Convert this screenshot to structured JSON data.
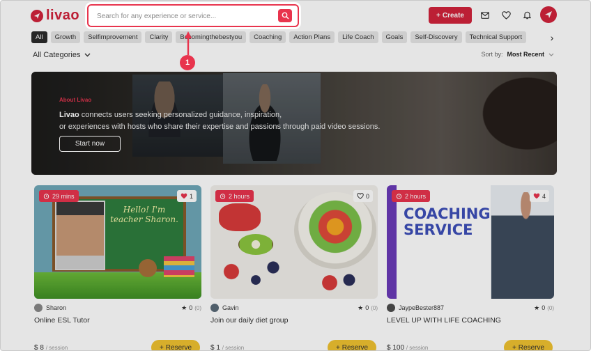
{
  "brand": {
    "name": "livao"
  },
  "search": {
    "placeholder": "Search for any experience or service..."
  },
  "header": {
    "create_label": "Create"
  },
  "categories": [
    "All",
    "Growth",
    "Selfimprovement",
    "Clarity",
    "Becomingthebestyou",
    "Coaching",
    "Action Plans",
    "Life Coach",
    "Goals",
    "Self-Discovery",
    "Technical Support"
  ],
  "filters": {
    "all_categories": "All Categories",
    "sort_label": "Sort by:",
    "sort_value": "Most Recent"
  },
  "hero": {
    "tag": "About Livao",
    "brand": "Livao",
    "text_line1": " connects users seeking personalized guidance, inspiration,",
    "text_line2": "or experiences with hosts who share their expertise and passions through paid video sessions.",
    "button": "Start now"
  },
  "cards": [
    {
      "duration": "29 mins",
      "likes": "1",
      "liked": true,
      "host": "Sharon",
      "rating": "0",
      "rating_count": "(0)",
      "title": "Online ESL Tutor",
      "price": "$ 8",
      "price_unit": "/ session",
      "reserve": "Reserve",
      "image_text": "Hello! I'm teacher Sharon."
    },
    {
      "duration": "2 hours",
      "likes": "0",
      "liked": false,
      "host": "Gavin",
      "rating": "0",
      "rating_count": "(0)",
      "title": "Join our daily diet group",
      "price": "$ 1",
      "price_unit": "/ session",
      "reserve": "Reserve"
    },
    {
      "duration": "2 hours",
      "likes": "4",
      "liked": true,
      "host": "JaypeBester887",
      "rating": "0",
      "rating_count": "(0)",
      "title": "LEVEL UP WITH LIFE COACHING",
      "price": "$ 100",
      "price_unit": "/ session",
      "reserve": "Reserve",
      "image_text": "COACHING SERVICE"
    }
  ],
  "annotation": {
    "step": "1"
  },
  "colors": {
    "brand": "#d2233c",
    "accent": "#e8344d",
    "reserve": "#f0c230"
  }
}
